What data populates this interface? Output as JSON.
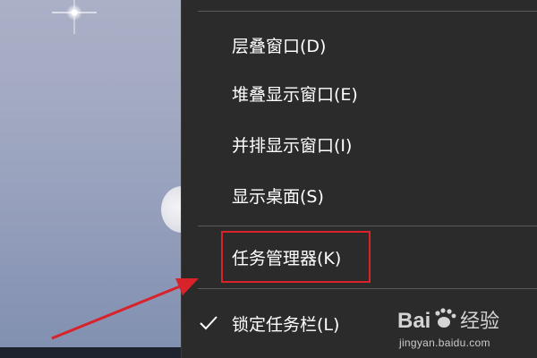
{
  "menu": {
    "items": [
      {
        "label": "层叠窗口(D)",
        "checked": false
      },
      {
        "label": "堆叠显示窗口(E)",
        "checked": false
      },
      {
        "label": "并排显示窗口(I)",
        "checked": false
      },
      {
        "label": "显示桌面(S)",
        "checked": false
      },
      {
        "label": "任务管理器(K)",
        "checked": false,
        "highlighted": true
      },
      {
        "label": "锁定任务栏(L)",
        "checked": true
      }
    ]
  },
  "annotation": {
    "highlight_color": "#d8232a",
    "arrow_color": "#d8232a"
  },
  "watermark": {
    "logo_text": "Bai经验",
    "site": "jingyan.baidu.com"
  },
  "colors": {
    "menu_bg": "#2b2b2b",
    "menu_text": "#ffffff",
    "separator": "#5a5a5a"
  }
}
